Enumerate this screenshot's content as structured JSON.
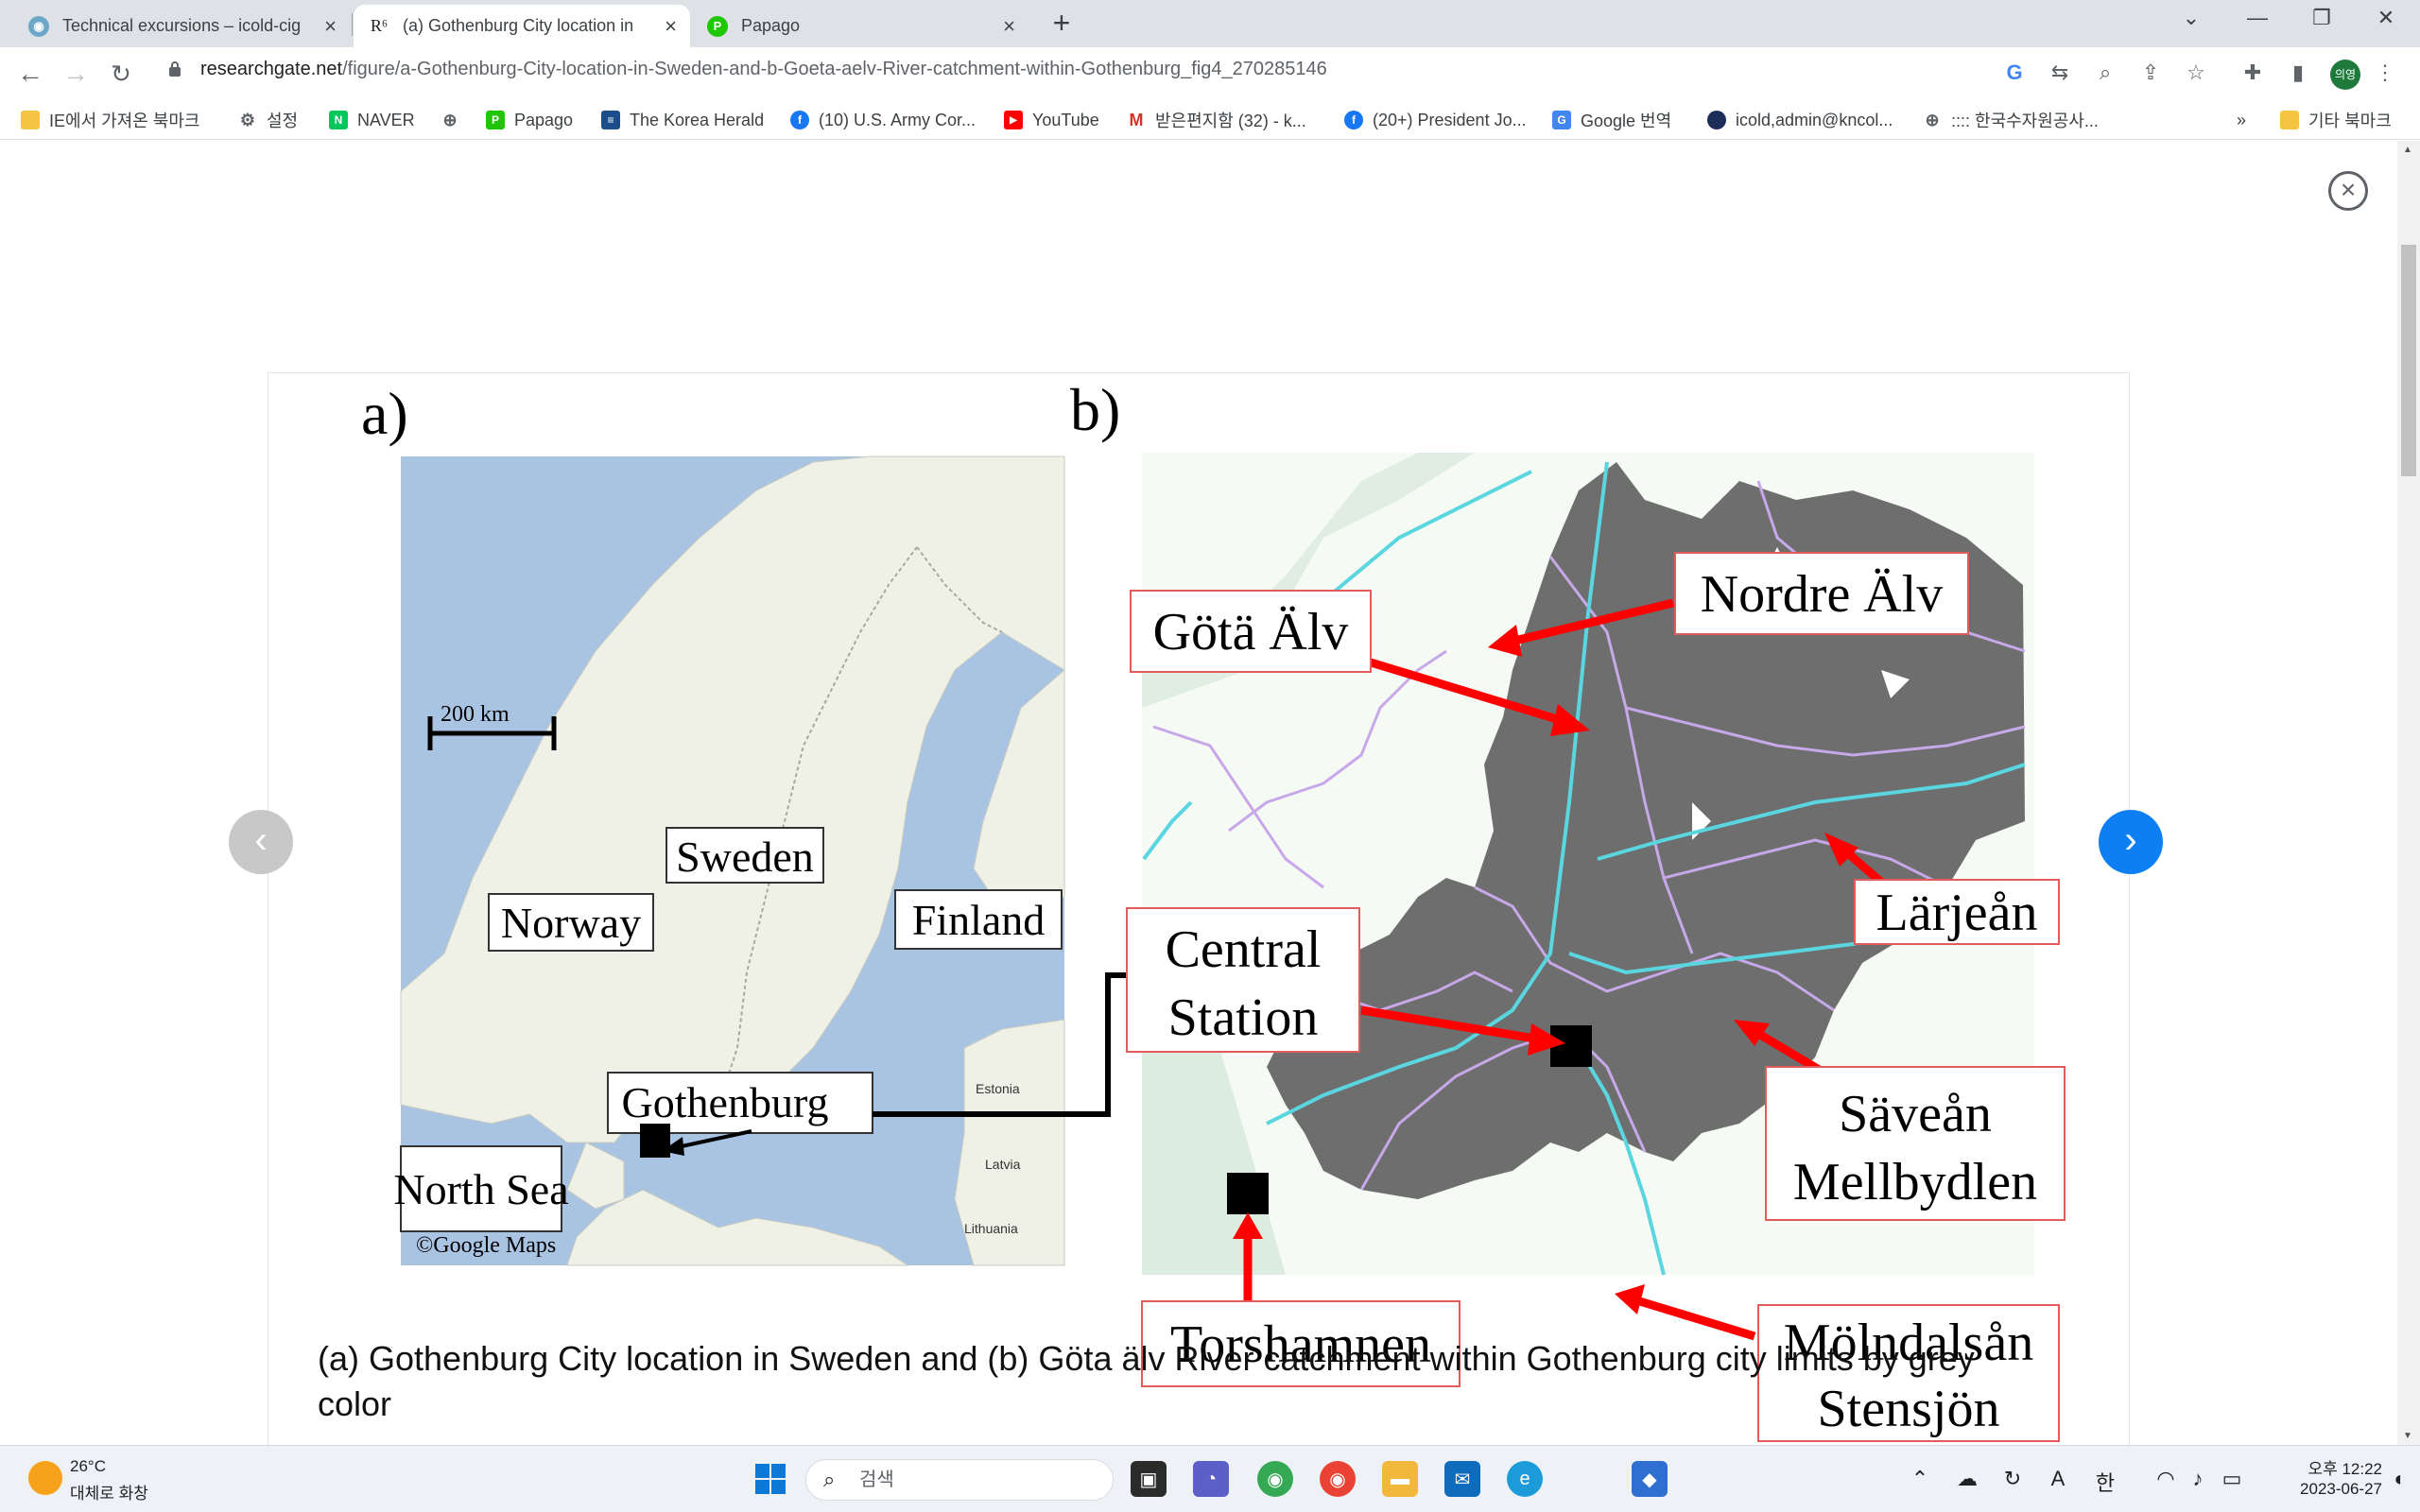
{
  "tabs": [
    {
      "title": "Technical excursions – icold-cig",
      "favicon": "icold-logo-icon"
    },
    {
      "title": "(a) Gothenburg City location in",
      "favicon": "researchgate-icon",
      "favicon_text": "R⁶"
    },
    {
      "title": "Papago",
      "favicon": "papago-icon"
    }
  ],
  "address_bar": {
    "domain": "researchgate.net",
    "path": "/figure/a-Gothenburg-City-location-in-Sweden-and-b-Goeta-aelv-River-catchment-within-Gothenburg_fig4_270285146"
  },
  "profile_label": "의영",
  "bookmarks": [
    {
      "label": "IE에서 가져온 북마크",
      "icon": "folder-icon",
      "color": "#f5c542"
    },
    {
      "label": "설정",
      "icon": "gear-icon",
      "color": "#5f6368"
    },
    {
      "label": "NAVER",
      "icon": "naver-icon",
      "color": "#03c75a",
      "glyph": "N"
    },
    {
      "label": "",
      "icon": "globe-icon",
      "color": "#5f6368"
    },
    {
      "label": "Papago",
      "icon": "papago-icon",
      "color": "#1ec800"
    },
    {
      "label": "The Korea Herald",
      "icon": "korea-herald-icon",
      "color": "#1a4e8a"
    },
    {
      "label": "(10) U.S. Army Cor...",
      "icon": "facebook-icon",
      "color": "#1877f2",
      "glyph": "f"
    },
    {
      "label": "YouTube",
      "icon": "youtube-icon",
      "color": "#ff0000",
      "glyph": "▶"
    },
    {
      "label": "받은편지함 (32) - k...",
      "icon": "gmail-icon",
      "color": "#d93025",
      "glyph": "M"
    },
    {
      "label": "(20+) President Jo...",
      "icon": "facebook-icon",
      "color": "#1877f2",
      "glyph": "f"
    },
    {
      "label": "Google 번역",
      "icon": "google-translate-icon",
      "color": "#4285f4",
      "glyph": "G"
    },
    {
      "label": "icold,admin@kncol...",
      "icon": "kncold-icon",
      "color": "#1c2d5a"
    },
    {
      "label": ":::: 한국수자원공사...",
      "icon": "globe-icon",
      "color": "#5f6368"
    },
    {
      "label": "기타 북마크",
      "icon": "folder-icon",
      "color": "#f5c542"
    }
  ],
  "bookmarks_more": "»",
  "figure": {
    "panel_a_label": "a)",
    "panel_b_label": "b)",
    "scale_bar": "200 km",
    "copyright": "©Google Maps",
    "countries": [
      "Sweden",
      "Norway",
      "Finland"
    ],
    "map_a_places": {
      "gothenburg": "Gothenburg",
      "north_sea": "North Sea",
      "estonia": "Estonia",
      "latvia": "Latvia",
      "lithuania": "Lithuania"
    },
    "map_b_labels": {
      "gota_alv": "Götä Älv",
      "nordre_alv": "Nordre Älv",
      "larjean": "Lärjeån",
      "central_station_1": "Central",
      "central_station_2": "Station",
      "savean": "Säveån",
      "mellbydlen": "Mellbydlen",
      "torshamnen": "Torshamnen",
      "molndalsan": "Mölndalsån",
      "stensjon": "Stensjön"
    }
  },
  "caption": "(a) Gothenburg City location in Sweden and (b) Göta älv River catchment within Gothenburg city limits by grey color",
  "taskbar": {
    "weather_temp": "26°C",
    "weather_desc": "대체로 화창",
    "search_placeholder": "검색",
    "time": "오후 12:22",
    "date": "2023-06-27",
    "ime_a": "A",
    "ime_han": "한"
  }
}
